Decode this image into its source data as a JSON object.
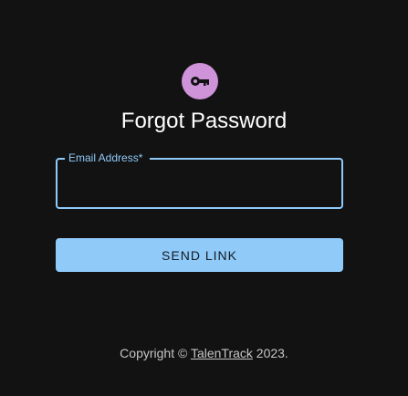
{
  "colors": {
    "background": "#121212",
    "avatar_bg": "#ce93d8",
    "accent": "#90caf9",
    "button_bg": "#90caf9"
  },
  "header": {
    "icon": "key-icon",
    "title": "Forgot Password"
  },
  "form": {
    "email_label": "Email Address",
    "required_mark": "*",
    "email_value": "",
    "submit_label": "SEND LINK"
  },
  "footer": {
    "copyright_prefix": "Copyright © ",
    "company_link": "TalenTrack",
    "copyright_suffix": " 2023."
  }
}
